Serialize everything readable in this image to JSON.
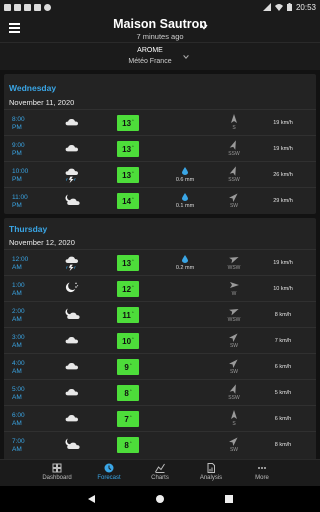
{
  "status": {
    "time": "20:53",
    "icons": [
      "notification-icon",
      "youtube-icon",
      "youtube-icon",
      "play-icon",
      "circle-icon"
    ],
    "right_icons": [
      "signal-icon",
      "wifi-icon",
      "battery-icon"
    ]
  },
  "header": {
    "title": "Maison Sautron",
    "subtitle": "7 minutes ago"
  },
  "model": {
    "name": "AROME",
    "source": "Météo France"
  },
  "colors": {
    "accent": "#3aa6e6",
    "temp_green": "#4ddd3a",
    "card": "#232323",
    "background": "#121212"
  },
  "days": [
    {
      "name": "Wednesday",
      "date": "November 11, 2020",
      "rows": [
        {
          "time": "8:00",
          "ampm": "PM",
          "icon": "cloud-icon",
          "temp": "13",
          "unit": "°",
          "rain": "",
          "dir": "S",
          "angle": 0,
          "speed": "19 km/h"
        },
        {
          "time": "9:00",
          "ampm": "PM",
          "icon": "cloud-icon",
          "temp": "13",
          "unit": "°",
          "rain": "",
          "dir": "SSW",
          "angle": 22,
          "speed": "19 km/h"
        },
        {
          "time": "10:00",
          "ampm": "PM",
          "icon": "storm-rain-icon",
          "temp": "13",
          "unit": "°",
          "rain": "0.6 mm",
          "dir": "SSW",
          "angle": 22,
          "speed": "26 km/h"
        },
        {
          "time": "11:00",
          "ampm": "PM",
          "icon": "moon-cloud-icon",
          "temp": "14",
          "unit": "°",
          "rain": "0.1 mm",
          "dir": "SW",
          "angle": 45,
          "speed": "29 km/h"
        }
      ]
    },
    {
      "name": "Thursday",
      "date": "November 12, 2020",
      "rows": [
        {
          "time": "12:00",
          "ampm": "AM",
          "icon": "storm-rain-icon",
          "temp": "13",
          "unit": "°",
          "rain": "0.2 mm",
          "dir": "WSW",
          "angle": 67,
          "speed": "19 km/h"
        },
        {
          "time": "1:00",
          "ampm": "AM",
          "icon": "moon-stars-icon",
          "temp": "12",
          "unit": "°",
          "rain": "",
          "dir": "W",
          "angle": 90,
          "speed": "10 km/h"
        },
        {
          "time": "2:00",
          "ampm": "AM",
          "icon": "moon-cloud-icon",
          "temp": "11",
          "unit": "°",
          "rain": "",
          "dir": "WSW",
          "angle": 67,
          "speed": "8 km/h"
        },
        {
          "time": "3:00",
          "ampm": "AM",
          "icon": "cloud-icon",
          "temp": "10",
          "unit": "°",
          "rain": "",
          "dir": "SW",
          "angle": 45,
          "speed": "7 km/h"
        },
        {
          "time": "4:00",
          "ampm": "AM",
          "icon": "cloud-icon",
          "temp": "9",
          "unit": "°",
          "rain": "",
          "dir": "SW",
          "angle": 45,
          "speed": "6 km/h"
        },
        {
          "time": "5:00",
          "ampm": "AM",
          "icon": "cloud-icon",
          "temp": "8",
          "unit": "°",
          "rain": "",
          "dir": "SSW",
          "angle": 22,
          "speed": "5 km/h"
        },
        {
          "time": "6:00",
          "ampm": "AM",
          "icon": "cloud-icon",
          "temp": "7",
          "unit": "°",
          "rain": "",
          "dir": "S",
          "angle": 0,
          "speed": "6 km/h"
        },
        {
          "time": "7:00",
          "ampm": "AM",
          "icon": "moon-cloud-icon",
          "temp": "8",
          "unit": "°",
          "rain": "",
          "dir": "SW",
          "angle": 45,
          "speed": "8 km/h"
        }
      ]
    }
  ],
  "nav": [
    {
      "label": "Dashboard",
      "icon": "dashboard-icon",
      "active": false
    },
    {
      "label": "Forecast",
      "icon": "forecast-icon",
      "active": true
    },
    {
      "label": "Charts",
      "icon": "charts-icon",
      "active": false
    },
    {
      "label": "Analysis",
      "icon": "analysis-icon",
      "active": false
    },
    {
      "label": "More",
      "icon": "more-icon",
      "active": false
    }
  ]
}
